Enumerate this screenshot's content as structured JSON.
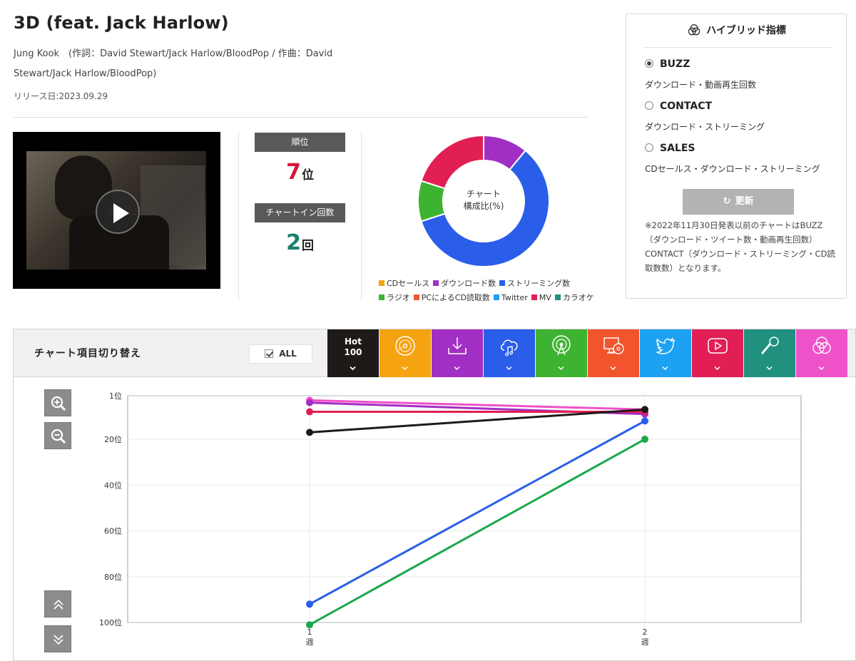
{
  "song": {
    "title": "3D (feat. Jack Harlow)",
    "credit_line1": "Jung Kook　(作詞：David Stewart/Jack Harlow/BloodPop / 作曲：David",
    "credit_line2": "Stewart/Jack Harlow/BloodPop)",
    "release": "リリース日:2023.09.29"
  },
  "stats": {
    "rank_label": "順位",
    "rank_value": "7",
    "rank_unit": "位",
    "chartin_label": "チャートイン回数",
    "chartin_value": "2",
    "chartin_unit": "回"
  },
  "donut": {
    "caption_line1": "チャート",
    "caption_line2": "構成比(%)",
    "legend_row1": [
      {
        "label": "CDセールス",
        "color": "#f5a311"
      },
      {
        "label": "ダウンロード数",
        "color": "#a22fc3"
      },
      {
        "label": "ストリーミング数",
        "color": "#2a5ee9"
      }
    ],
    "legend_row2": [
      {
        "label": "ラジオ",
        "color": "#3eb331"
      },
      {
        "label": "PCによるCD読取数",
        "color": "#f2552c"
      },
      {
        "label": "Twitter",
        "color": "#1da1f2"
      },
      {
        "label": "MV",
        "color": "#e11f54"
      },
      {
        "label": "カラオケ",
        "color": "#20917e"
      }
    ]
  },
  "hybrid": {
    "title": "ハイブリッド指標",
    "options": [
      {
        "label": "BUZZ",
        "desc": "ダウンロード・動画再生回数",
        "selected": true
      },
      {
        "label": "CONTACT",
        "desc": "ダウンロード・ストリーミング",
        "selected": false
      },
      {
        "label": "SALES",
        "desc": "CDセールス・ダウンロード・ストリーミング",
        "selected": false
      }
    ],
    "update_label": "更新",
    "note": "※2022年11月30日発表以前のチャートはBUZZ（ダウンロード・ツイート数・動画再生回数）CONTACT（ダウンロード・ストリーミング・CD読取数数）となります。"
  },
  "toolbar": {
    "title": "チャート項目切り替え",
    "all_label": "ALL",
    "hot_label_1": "Hot",
    "hot_label_2": "100",
    "tabs": [
      {
        "name": "hot100",
        "color": "#1e1a17",
        "icon": "hot-100-label"
      },
      {
        "name": "cd-sales",
        "color": "#f5a311",
        "icon": "cd-icon"
      },
      {
        "name": "download",
        "color": "#a22fc3",
        "icon": "download-icon"
      },
      {
        "name": "streaming",
        "color": "#2a5ee9",
        "icon": "cloud-music-icon"
      },
      {
        "name": "radio",
        "color": "#3eb331",
        "icon": "radio-icon"
      },
      {
        "name": "pc-cd-read",
        "color": "#f2552c",
        "icon": "pc-cd-icon"
      },
      {
        "name": "twitter",
        "color": "#1da1f2",
        "icon": "twitter-icon"
      },
      {
        "name": "mv",
        "color": "#e11f54",
        "icon": "youtube-icon"
      },
      {
        "name": "karaoke",
        "color": "#20917e",
        "icon": "microphone-icon"
      },
      {
        "name": "hybrid",
        "color": "#ee52c8",
        "icon": "venn-icon"
      }
    ]
  },
  "chart_data": [
    {
      "type": "pie",
      "title": "チャート 構成比(%)",
      "categories": [
        "ダウンロード数",
        "ストリーミング数",
        "ラジオ",
        "MV"
      ],
      "values": [
        11,
        59,
        10,
        20
      ],
      "colors": [
        "#a22fc3",
        "#2a5ee9",
        "#3eb331",
        "#e11f54"
      ]
    },
    {
      "type": "line",
      "x": [
        "1週",
        "2週"
      ],
      "x_ticks": [
        {
          "num": "1",
          "unit": "週"
        },
        {
          "num": "2",
          "unit": "週"
        }
      ],
      "y_ticks": [
        "1位",
        "20位",
        "40位",
        "60位",
        "80位",
        "100位"
      ],
      "y_tick_values": [
        1,
        20,
        40,
        60,
        80,
        100
      ],
      "ylim": [
        1,
        100
      ],
      "y_inverted": true,
      "grid": true,
      "series": [
        {
          "color": "#ee52c8",
          "values": [
            3,
            7
          ]
        },
        {
          "color": "#a22fc3",
          "values": [
            4,
            9
          ]
        },
        {
          "color": "#e11f54",
          "values": [
            8,
            8
          ]
        },
        {
          "color": "#1e1a17",
          "values": [
            17,
            7
          ]
        },
        {
          "color": "#2a5ee9",
          "values": [
            92,
            12
          ]
        },
        {
          "color": "#1aa84c",
          "values": [
            101,
            20
          ]
        }
      ]
    }
  ]
}
